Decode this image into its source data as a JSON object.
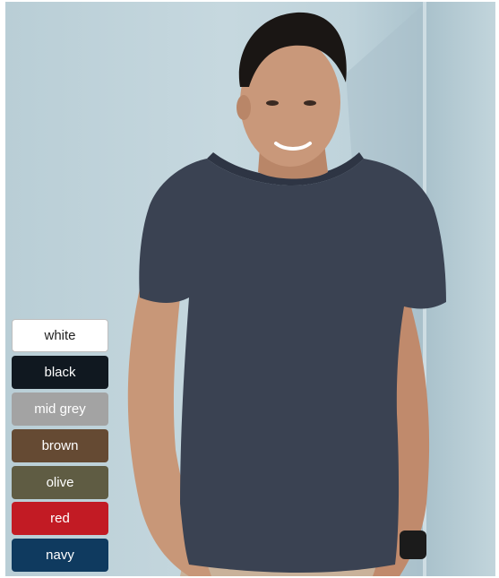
{
  "product": {
    "photo_icon": "man-in-tshirt-photo",
    "shirt_color": "#3a4252"
  },
  "color_options": [
    {
      "label": "white",
      "color": "#ffffff"
    },
    {
      "label": "black",
      "color": "#101820"
    },
    {
      "label": "mid grey",
      "color": "#a3a3a3"
    },
    {
      "label": "brown",
      "color": "#654a33"
    },
    {
      "label": "olive",
      "color": "#5f5c43"
    },
    {
      "label": "red",
      "color": "#c21b24"
    },
    {
      "label": "navy",
      "color": "#0f3a5f"
    }
  ]
}
